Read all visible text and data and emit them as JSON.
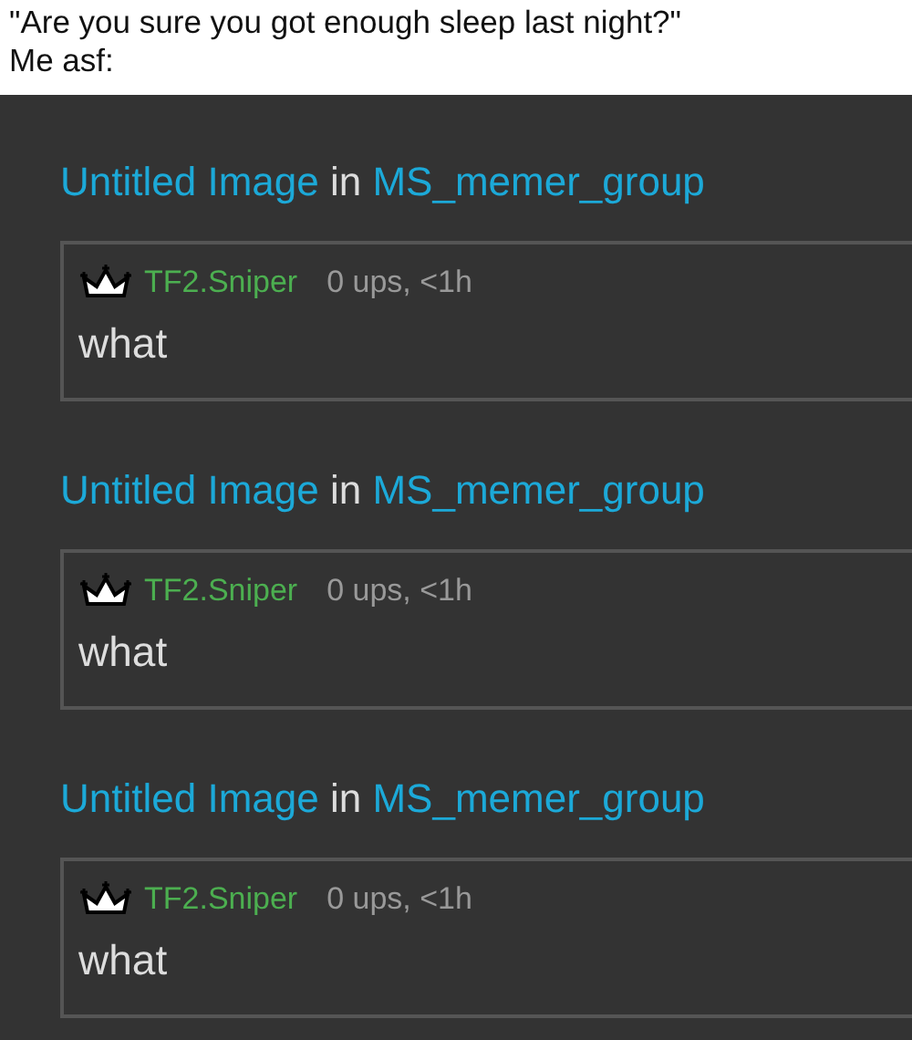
{
  "caption": [
    "\"Are you sure you got enough sleep last night?\"",
    "Me asf:"
  ],
  "comments": [
    {
      "post_title": "Untitled Image",
      "joiner": "in",
      "group": "MS_memer_group",
      "user": "TF2.Sniper",
      "meta": "0 ups, <1h",
      "text": "what"
    },
    {
      "post_title": "Untitled Image",
      "joiner": "in",
      "group": "MS_memer_group",
      "user": "TF2.Sniper",
      "meta": "0 ups, <1h",
      "text": "what"
    },
    {
      "post_title": "Untitled Image",
      "joiner": "in",
      "group": "MS_memer_group",
      "user": "TF2.Sniper",
      "meta": "0 ups, <1h",
      "text": "what"
    }
  ]
}
